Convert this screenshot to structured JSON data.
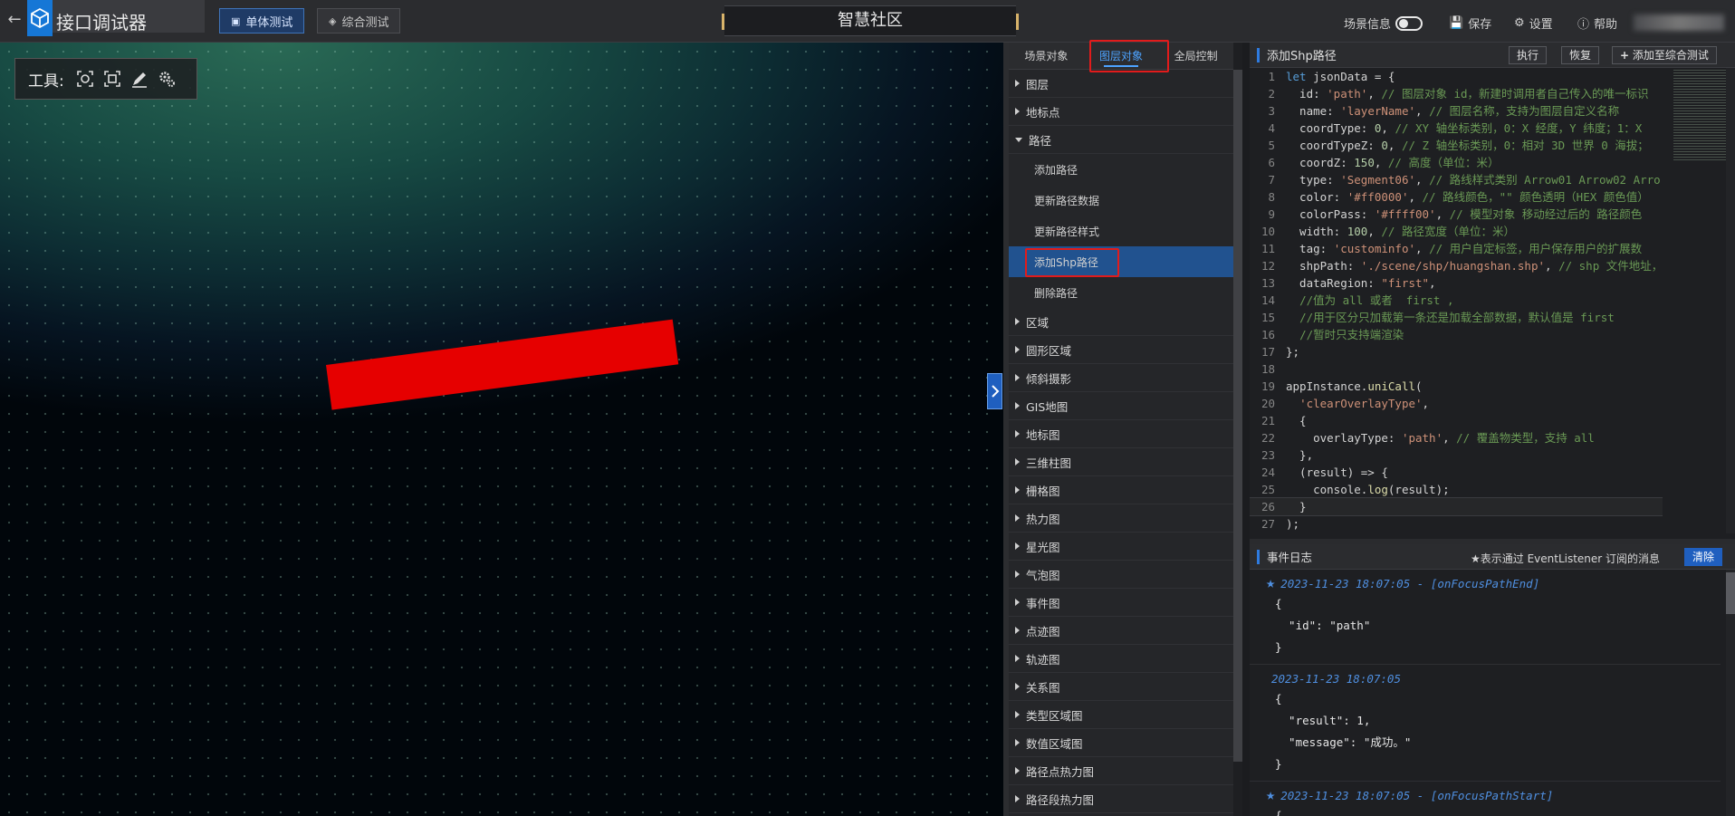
{
  "topbar": {
    "app_title": "接口调试器",
    "btn_unit": "单体测试",
    "btn_integrated": "综合测试",
    "scene_name": "智慧社区",
    "scene_info": "场景信息",
    "save": "保存",
    "settings": "设置",
    "help": "帮助"
  },
  "viewport": {
    "tool_label": "工具:",
    "path_color": "#e60000"
  },
  "mid": {
    "tabs": [
      "场景对象",
      "图层对象",
      "全局控制"
    ],
    "groups_top": [
      "图层",
      "地标点"
    ],
    "open_group": "路径",
    "items": [
      "添加路径",
      "更新路径数据",
      "更新路径样式",
      "添加Shp路径",
      "删除路径"
    ],
    "groups_bottom": [
      "区域",
      "圆形区域",
      "倾斜摄影",
      "GIS地图",
      "地标图",
      "三维柱图",
      "栅格图",
      "热力图",
      "星光图",
      "气泡图",
      "事件图",
      "点迹图",
      "轨迹图",
      "关系图",
      "类型区域图",
      "数值区域图",
      "路径点热力图",
      "路径段热力图"
    ]
  },
  "code": {
    "title": "添加Shp路径",
    "execute": "执行",
    "restore": "恢复",
    "add_to_integrated": "添加至综合测试",
    "lines": [
      "let jsonData = {",
      "  id: 'path', // 图层对象 id，新建时调用者自己传入的唯一标识",
      "  name: 'layerName', // 图层名称，支持为图层自定义名称",
      "  coordType: 0, // XY 轴坐标类别，0：X 经度，Y 纬度；1：X",
      "  coordTypeZ: 0, // Z 轴坐标类别，0：相对 3D 世界 0 海拔；",
      "  coordZ: 150, // 高度（单位：米）",
      "  type: 'Segment06', // 路线样式类别 Arrow01 Arrow02 Arro",
      "  color: '#ff0000', // 路线颜色，\"\" 颜色透明（HEX 颜色值）",
      "  colorPass: '#ffff00', // 模型对象 移动经过后的 路径颜色",
      "  width: 100, // 路径宽度（单位：米）",
      "  tag: 'custominfo', // 用户自定标签，用户保存用户的扩展数",
      "  shpPath: './scene/shp/huangshan.shp', // shp 文件地址，",
      "  dataRegion: \"first\",",
      "  //值为 all 或者  first ,",
      "  //用于区分只加载第一条还是加载全部数据，默认值是 first",
      "  //暂时只支持端渲染",
      "};",
      "",
      "appInstance.uniCall(",
      "  'clearOverlayType',",
      "  {",
      "    overlayType: 'path', // 覆盖物类型，支持 all",
      "  },",
      "  (result) => {",
      "    console.log(result);",
      "  }",
      ");"
    ]
  },
  "log": {
    "title": "事件日志",
    "note": "★表示通过 EventListener 订阅的消息",
    "clear": "清除",
    "entries": [
      {
        "starred": true,
        "time": "2023-11-23 18:07:05 - [onFocusPathEnd]",
        "body": [
          "{",
          "  \"id\": \"path\"",
          "}"
        ]
      },
      {
        "starred": false,
        "time": "2023-11-23 18:07:05",
        "body": [
          "{",
          "  \"result\": 1,",
          "  \"message\": \"成功。\"",
          "}"
        ]
      },
      {
        "starred": true,
        "time": "2023-11-23 18:07:05 - [onFocusPathStart]",
        "body": [
          "{"
        ]
      }
    ]
  }
}
